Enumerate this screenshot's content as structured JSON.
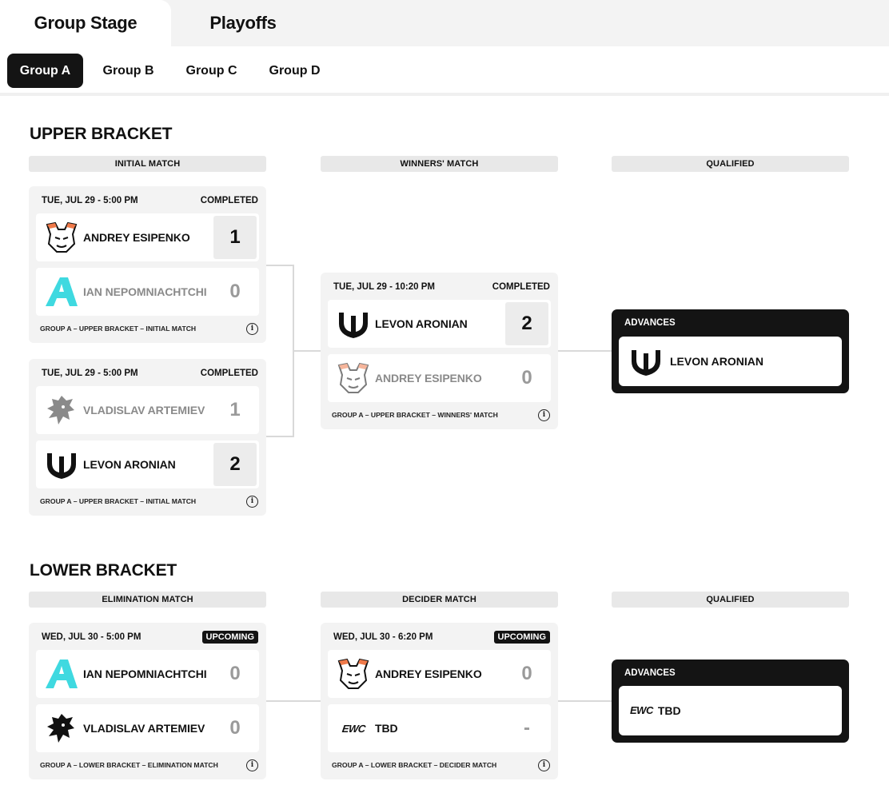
{
  "stage_tabs": [
    {
      "label": "Group Stage",
      "active": true
    },
    {
      "label": "Playoffs",
      "active": false
    }
  ],
  "group_tabs": [
    {
      "label": "Group A",
      "active": true
    },
    {
      "label": "Group B",
      "active": false
    },
    {
      "label": "Group C",
      "active": false
    },
    {
      "label": "Group D",
      "active": false
    }
  ],
  "upper": {
    "title": "UPPER BRACKET",
    "headers": [
      "INITIAL MATCH",
      "WINNERS' MATCH",
      "QUALIFIED"
    ],
    "match1": {
      "datetime": "TUE, JUL 29 - 5:00 PM",
      "status": "COMPLETED",
      "p1": {
        "name": "ANDREY ESIPENKO",
        "score": "1",
        "logo": "virtus-pro-bear-icon"
      },
      "p2": {
        "name": "IAN NEPOMNIACHTCHI",
        "score": "0",
        "logo": "team-a-logo-icon"
      },
      "footer": "GROUP A – UPPER BRACKET – INITIAL MATCH"
    },
    "match2": {
      "datetime": "TUE, JUL 29 - 5:00 PM",
      "status": "COMPLETED",
      "p1": {
        "name": "VLADISLAV ARTEMIEV",
        "score": "1",
        "logo": "spirit-dragon-icon"
      },
      "p2": {
        "name": "LEVON ARONIAN",
        "score": "2",
        "logo": "trident-logo-icon"
      },
      "footer": "GROUP A – UPPER BRACKET – INITIAL MATCH"
    },
    "match3": {
      "datetime": "TUE, JUL 29 - 10:20 PM",
      "status": "COMPLETED",
      "p1": {
        "name": "LEVON ARONIAN",
        "score": "2",
        "logo": "trident-logo-icon"
      },
      "p2": {
        "name": "ANDREY ESIPENKO",
        "score": "0",
        "logo": "virtus-pro-bear-icon"
      },
      "footer": "GROUP A – UPPER BRACKET – WINNERS' MATCH"
    },
    "qualified": {
      "label": "ADVANCES",
      "name": "LEVON ARONIAN",
      "logo": "trident-logo-icon"
    }
  },
  "lower": {
    "title": "LOWER BRACKET",
    "headers": [
      "ELIMINATION MATCH",
      "DECIDER MATCH",
      "QUALIFIED"
    ],
    "match1": {
      "datetime": "WED, JUL 30 - 5:00 PM",
      "status": "UPCOMING",
      "p1": {
        "name": "IAN NEPOMNIACHTCHI",
        "score": "0",
        "logo": "team-a-logo-icon"
      },
      "p2": {
        "name": "VLADISLAV ARTEMIEV",
        "score": "0",
        "logo": "spirit-dragon-icon"
      },
      "footer": "GROUP A – LOWER BRACKET – ELIMINATION MATCH"
    },
    "match2": {
      "datetime": "WED, JUL 30 - 6:20 PM",
      "status": "UPCOMING",
      "p1": {
        "name": "ANDREY ESIPENKO",
        "score": "0",
        "logo": "virtus-pro-bear-icon"
      },
      "p2": {
        "name": "TBD",
        "score": "-",
        "logo": "ewc-logo-icon",
        "logo_text": "EWC"
      },
      "footer": "GROUP A – LOWER BRACKET – DECIDER MATCH"
    },
    "qualified": {
      "label": "ADVANCES",
      "name": "TBD",
      "logo": "ewc-logo-icon",
      "logo_text": "EWC"
    }
  },
  "colors": {
    "dark": "#141414",
    "panel": "#f3f3f3",
    "header": "#e8e8e8",
    "team_a_cyan": "#3fd9e0",
    "vp_orange": "#f07a4a"
  }
}
